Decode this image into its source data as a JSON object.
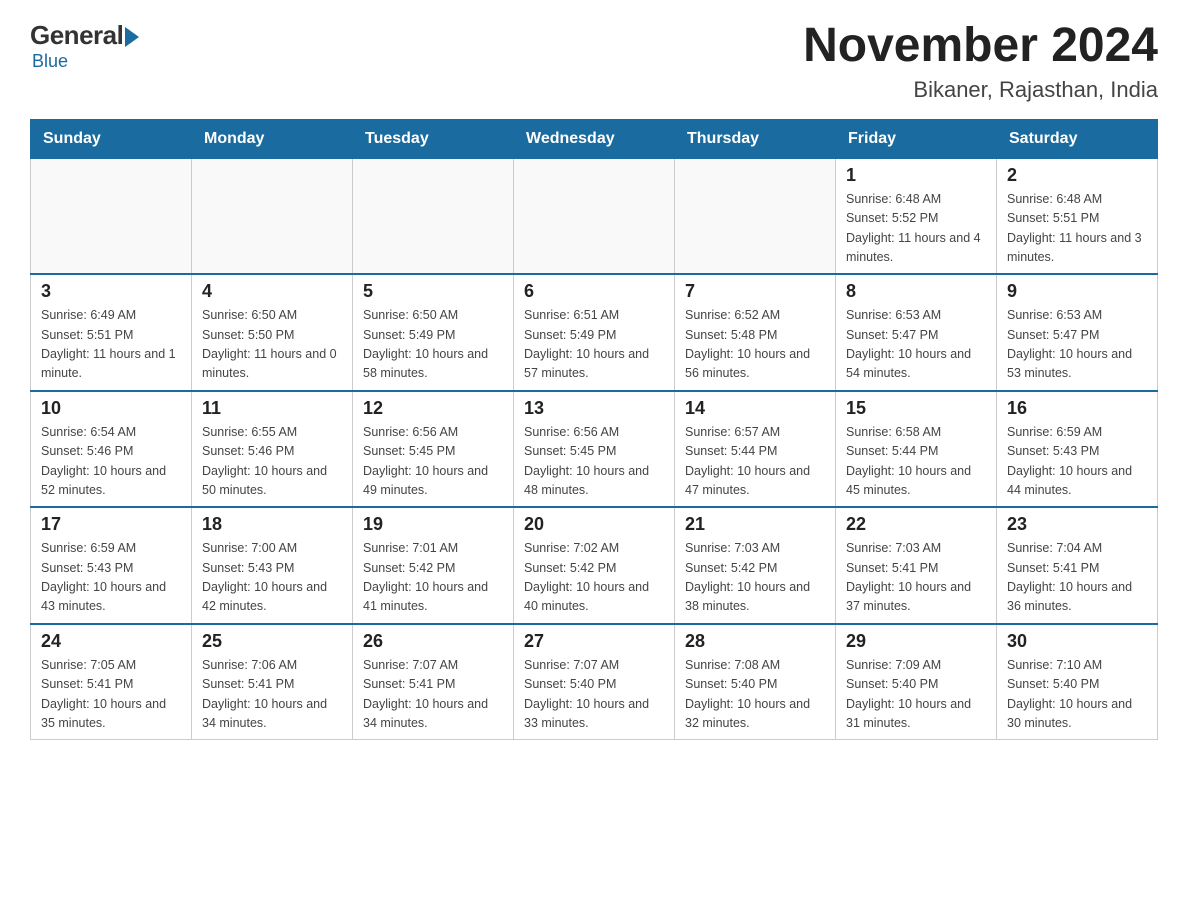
{
  "logo": {
    "general": "General",
    "blue": "Blue"
  },
  "title": "November 2024",
  "subtitle": "Bikaner, Rajasthan, India",
  "days_of_week": [
    "Sunday",
    "Monday",
    "Tuesday",
    "Wednesday",
    "Thursday",
    "Friday",
    "Saturday"
  ],
  "weeks": [
    [
      {
        "day": "",
        "info": ""
      },
      {
        "day": "",
        "info": ""
      },
      {
        "day": "",
        "info": ""
      },
      {
        "day": "",
        "info": ""
      },
      {
        "day": "",
        "info": ""
      },
      {
        "day": "1",
        "info": "Sunrise: 6:48 AM\nSunset: 5:52 PM\nDaylight: 11 hours and 4 minutes."
      },
      {
        "day": "2",
        "info": "Sunrise: 6:48 AM\nSunset: 5:51 PM\nDaylight: 11 hours and 3 minutes."
      }
    ],
    [
      {
        "day": "3",
        "info": "Sunrise: 6:49 AM\nSunset: 5:51 PM\nDaylight: 11 hours and 1 minute."
      },
      {
        "day": "4",
        "info": "Sunrise: 6:50 AM\nSunset: 5:50 PM\nDaylight: 11 hours and 0 minutes."
      },
      {
        "day": "5",
        "info": "Sunrise: 6:50 AM\nSunset: 5:49 PM\nDaylight: 10 hours and 58 minutes."
      },
      {
        "day": "6",
        "info": "Sunrise: 6:51 AM\nSunset: 5:49 PM\nDaylight: 10 hours and 57 minutes."
      },
      {
        "day": "7",
        "info": "Sunrise: 6:52 AM\nSunset: 5:48 PM\nDaylight: 10 hours and 56 minutes."
      },
      {
        "day": "8",
        "info": "Sunrise: 6:53 AM\nSunset: 5:47 PM\nDaylight: 10 hours and 54 minutes."
      },
      {
        "day": "9",
        "info": "Sunrise: 6:53 AM\nSunset: 5:47 PM\nDaylight: 10 hours and 53 minutes."
      }
    ],
    [
      {
        "day": "10",
        "info": "Sunrise: 6:54 AM\nSunset: 5:46 PM\nDaylight: 10 hours and 52 minutes."
      },
      {
        "day": "11",
        "info": "Sunrise: 6:55 AM\nSunset: 5:46 PM\nDaylight: 10 hours and 50 minutes."
      },
      {
        "day": "12",
        "info": "Sunrise: 6:56 AM\nSunset: 5:45 PM\nDaylight: 10 hours and 49 minutes."
      },
      {
        "day": "13",
        "info": "Sunrise: 6:56 AM\nSunset: 5:45 PM\nDaylight: 10 hours and 48 minutes."
      },
      {
        "day": "14",
        "info": "Sunrise: 6:57 AM\nSunset: 5:44 PM\nDaylight: 10 hours and 47 minutes."
      },
      {
        "day": "15",
        "info": "Sunrise: 6:58 AM\nSunset: 5:44 PM\nDaylight: 10 hours and 45 minutes."
      },
      {
        "day": "16",
        "info": "Sunrise: 6:59 AM\nSunset: 5:43 PM\nDaylight: 10 hours and 44 minutes."
      }
    ],
    [
      {
        "day": "17",
        "info": "Sunrise: 6:59 AM\nSunset: 5:43 PM\nDaylight: 10 hours and 43 minutes."
      },
      {
        "day": "18",
        "info": "Sunrise: 7:00 AM\nSunset: 5:43 PM\nDaylight: 10 hours and 42 minutes."
      },
      {
        "day": "19",
        "info": "Sunrise: 7:01 AM\nSunset: 5:42 PM\nDaylight: 10 hours and 41 minutes."
      },
      {
        "day": "20",
        "info": "Sunrise: 7:02 AM\nSunset: 5:42 PM\nDaylight: 10 hours and 40 minutes."
      },
      {
        "day": "21",
        "info": "Sunrise: 7:03 AM\nSunset: 5:42 PM\nDaylight: 10 hours and 38 minutes."
      },
      {
        "day": "22",
        "info": "Sunrise: 7:03 AM\nSunset: 5:41 PM\nDaylight: 10 hours and 37 minutes."
      },
      {
        "day": "23",
        "info": "Sunrise: 7:04 AM\nSunset: 5:41 PM\nDaylight: 10 hours and 36 minutes."
      }
    ],
    [
      {
        "day": "24",
        "info": "Sunrise: 7:05 AM\nSunset: 5:41 PM\nDaylight: 10 hours and 35 minutes."
      },
      {
        "day": "25",
        "info": "Sunrise: 7:06 AM\nSunset: 5:41 PM\nDaylight: 10 hours and 34 minutes."
      },
      {
        "day": "26",
        "info": "Sunrise: 7:07 AM\nSunset: 5:41 PM\nDaylight: 10 hours and 34 minutes."
      },
      {
        "day": "27",
        "info": "Sunrise: 7:07 AM\nSunset: 5:40 PM\nDaylight: 10 hours and 33 minutes."
      },
      {
        "day": "28",
        "info": "Sunrise: 7:08 AM\nSunset: 5:40 PM\nDaylight: 10 hours and 32 minutes."
      },
      {
        "day": "29",
        "info": "Sunrise: 7:09 AM\nSunset: 5:40 PM\nDaylight: 10 hours and 31 minutes."
      },
      {
        "day": "30",
        "info": "Sunrise: 7:10 AM\nSunset: 5:40 PM\nDaylight: 10 hours and 30 minutes."
      }
    ]
  ]
}
